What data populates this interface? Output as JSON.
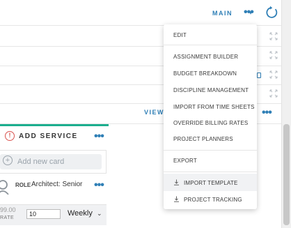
{
  "header": {
    "main_label": "MAIN",
    "main_caret": "▾",
    "more_dots": "•••"
  },
  "content": {
    "view_label": "VIEW",
    "more_dots": "•••"
  },
  "add_service": {
    "info_glyph": "!",
    "title": "ADD SERVICE",
    "more_dots": "•••",
    "new_card_placeholder": "Add new card",
    "plus_glyph": "+",
    "role_label": "ROLE",
    "role_value": "Architect: Senior",
    "role_more_dots": "•••",
    "price": "99.00",
    "rate_label": "RATE",
    "quantity": "10",
    "frequency": "Weekly",
    "frequency_caret": "⌄"
  },
  "menu": {
    "items": [
      {
        "label": "EDIT"
      },
      {
        "label": "ASSIGNMENT BUILDER"
      },
      {
        "label": "BUDGET BREAKDOWN"
      },
      {
        "label": "DISCIPLINE MANAGEMENT"
      },
      {
        "label": "IMPORT FROM TIME SHEETS"
      },
      {
        "label": "OVERRIDE BILLING RATES"
      },
      {
        "label": "PROJECT PLANNERS"
      },
      {
        "label": "EXPORT"
      },
      {
        "label": "IMPORT TEMPLATE",
        "icon": "download-icon"
      },
      {
        "label": "PROJECT TRACKING",
        "icon": "download-icon"
      }
    ]
  },
  "colors": {
    "accent": "#2f7fb6",
    "green": "#1cae8e",
    "alert": "#d9534f"
  }
}
